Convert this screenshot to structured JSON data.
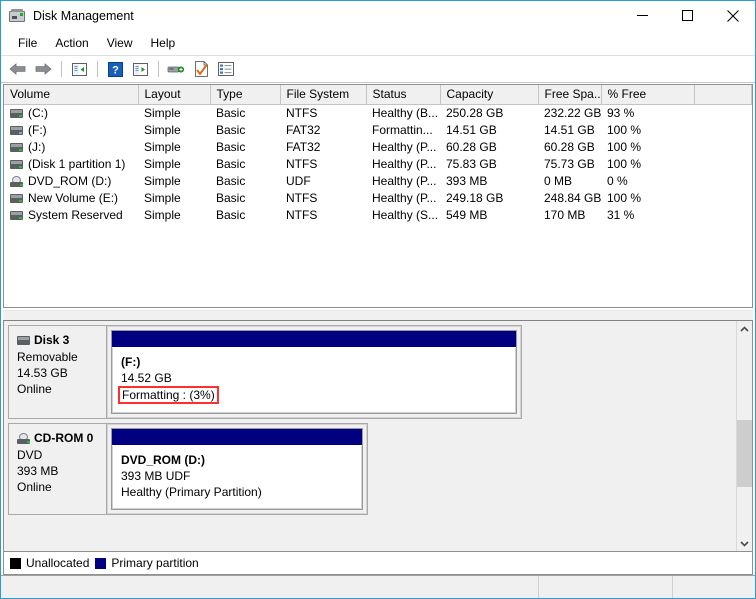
{
  "window": {
    "title": "Disk Management",
    "app_icon": "disk-drive-icon",
    "controls": {
      "minimize": "minimize-icon",
      "maximize": "maximize-icon",
      "close": "close-icon"
    }
  },
  "menubar": {
    "items": [
      "File",
      "Action",
      "View",
      "Help"
    ]
  },
  "toolbar": {
    "items": [
      {
        "name": "back-icon",
        "label": "Back"
      },
      {
        "name": "forward-icon",
        "label": "Forward"
      },
      {
        "name": "show-hide-console-tree-icon",
        "label": "Show/Hide Console Tree"
      },
      {
        "name": "help-icon",
        "label": "Help"
      },
      {
        "name": "show-hide-action-pane-icon",
        "label": "Show/Hide Action Pane"
      },
      {
        "name": "rescan-disks-icon",
        "label": "Rescan Disks"
      },
      {
        "name": "properties-icon",
        "label": "Properties"
      },
      {
        "name": "list-view-icon",
        "label": "List View"
      }
    ]
  },
  "volume_list": {
    "columns": [
      "Volume",
      "Layout",
      "Type",
      "File System",
      "Status",
      "Capacity",
      "Free Spa...",
      "% Free"
    ],
    "rows": [
      {
        "icon": "drive-icon",
        "volume": "(C:)",
        "layout": "Simple",
        "type": "Basic",
        "file_system": "NTFS",
        "status": "Healthy (B...",
        "capacity": "250.28 GB",
        "free_space": "232.22 GB",
        "percent_free": "93 %"
      },
      {
        "icon": "drive-icon-inactive",
        "volume": "(F:)",
        "layout": "Simple",
        "type": "Basic",
        "file_system": "FAT32",
        "status": "Formattin...",
        "capacity": "14.51 GB",
        "free_space": "14.51 GB",
        "percent_free": "100 %"
      },
      {
        "icon": "drive-icon",
        "volume": "(J:)",
        "layout": "Simple",
        "type": "Basic",
        "file_system": "FAT32",
        "status": "Healthy (P...",
        "capacity": "60.28 GB",
        "free_space": "60.28 GB",
        "percent_free": "100 %"
      },
      {
        "icon": "drive-icon",
        "volume": "(Disk 1 partition 1)",
        "layout": "Simple",
        "type": "Basic",
        "file_system": "NTFS",
        "status": "Healthy (P...",
        "capacity": "75.83 GB",
        "free_space": "75.73 GB",
        "percent_free": "100 %"
      },
      {
        "icon": "cdrom-icon",
        "volume": "DVD_ROM (D:)",
        "layout": "Simple",
        "type": "Basic",
        "file_system": "UDF",
        "status": "Healthy (P...",
        "capacity": "393 MB",
        "free_space": "0 MB",
        "percent_free": "0 %"
      },
      {
        "icon": "drive-icon",
        "volume": "New Volume (E:)",
        "layout": "Simple",
        "type": "Basic",
        "file_system": "NTFS",
        "status": "Healthy (P...",
        "capacity": "249.18 GB",
        "free_space": "248.84 GB",
        "percent_free": "100 %"
      },
      {
        "icon": "drive-icon",
        "volume": "System Reserved",
        "layout": "Simple",
        "type": "Basic",
        "file_system": "NTFS",
        "status": "Healthy (S...",
        "capacity": "549 MB",
        "free_space": "170 MB",
        "percent_free": "31 %"
      }
    ]
  },
  "graphical_view": {
    "disks": [
      {
        "icon": "disk-icon",
        "name": "Disk 3",
        "media_type": "Removable",
        "size": "14.53 GB",
        "state": "Online",
        "partitions": [
          {
            "bar_color": "#000080",
            "title": "(F:)",
            "size": "14.52 GB",
            "status": "Formatting : (3%)",
            "status_highlighted": true,
            "highlight_color": "#ff2f2f"
          }
        ]
      },
      {
        "icon": "cdrom-icon",
        "name": "CD-ROM 0",
        "media_type": "DVD",
        "size": "393 MB",
        "state": "Online",
        "partitions": [
          {
            "bar_color": "#000080",
            "title": "DVD_ROM  (D:)",
            "size": "393 MB UDF",
            "status": "Healthy (Primary Partition)",
            "status_highlighted": false
          }
        ]
      }
    ]
  },
  "legend": {
    "items": [
      {
        "color": "#000000",
        "label": "Unallocated"
      },
      {
        "color": "#000080",
        "label": "Primary partition"
      }
    ]
  },
  "statusbar": {
    "segments": [
      "",
      "",
      ""
    ]
  }
}
